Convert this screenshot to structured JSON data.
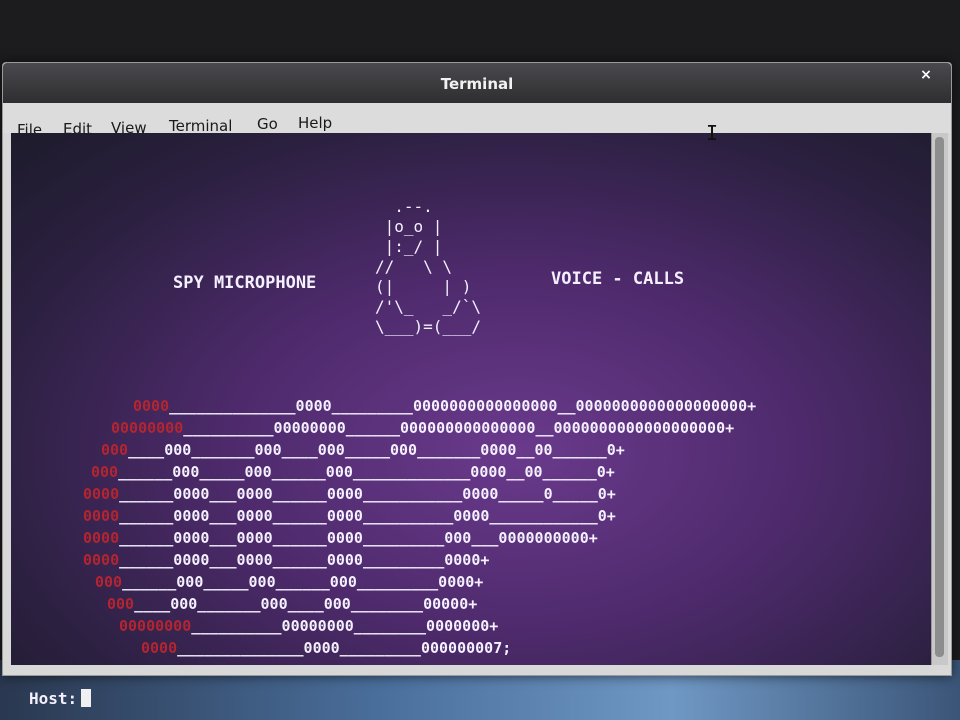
{
  "window": {
    "title": "Terminal",
    "close_label": "×"
  },
  "menu": [
    {
      "label": "File"
    },
    {
      "label": "Edit"
    },
    {
      "label": "View"
    },
    {
      "label": "Terminal"
    },
    {
      "label": "Go"
    },
    {
      "label": "Help"
    }
  ],
  "terminal": {
    "tux_art": "  .--.\n |o_o |\n |:_/ |\n//   \\ \\\n(|     | )\n/'\\_   _/`\\\n\\___)=(___/",
    "left_label": "SPY MICROPHONE",
    "right_label": "VOICE - CALLS",
    "code_lines": [
      {
        "red": "0000",
        "white": "______________0000_________0000000000000000__0000000000000000000+"
      },
      {
        "red": "00000000",
        "white": "__________00000000______000000000000000__0000000000000000000+"
      },
      {
        "red": "000",
        "white": "____000_______000____000_____000_______0000__00______0+"
      },
      {
        "red": "000",
        "white": "______000_____000______000_____________0000__00______0+"
      },
      {
        "red": "0000",
        "white": "______0000___0000______0000___________0000_____0_____0+"
      },
      {
        "red": "0000",
        "white": "______0000___0000______0000__________0000____________0+"
      },
      {
        "red": "0000",
        "white": "______0000___0000______0000_________000___0000000000+"
      },
      {
        "red": "0000",
        "white": "______0000___0000______0000_________0000+"
      },
      {
        "red": "000",
        "white": "______000_____000______000_________0000+"
      },
      {
        "red": "000",
        "white": "____000_______000____000________00000+"
      },
      {
        "red": "00000000",
        "white": "__________00000000________0000000+"
      },
      {
        "red": "0000",
        "white": "______________0000_________000000007;"
      }
    ],
    "prompt": "Host:"
  },
  "colors": {
    "accent_red": "#b32530",
    "terminal_purple": "#4e2a6c"
  }
}
